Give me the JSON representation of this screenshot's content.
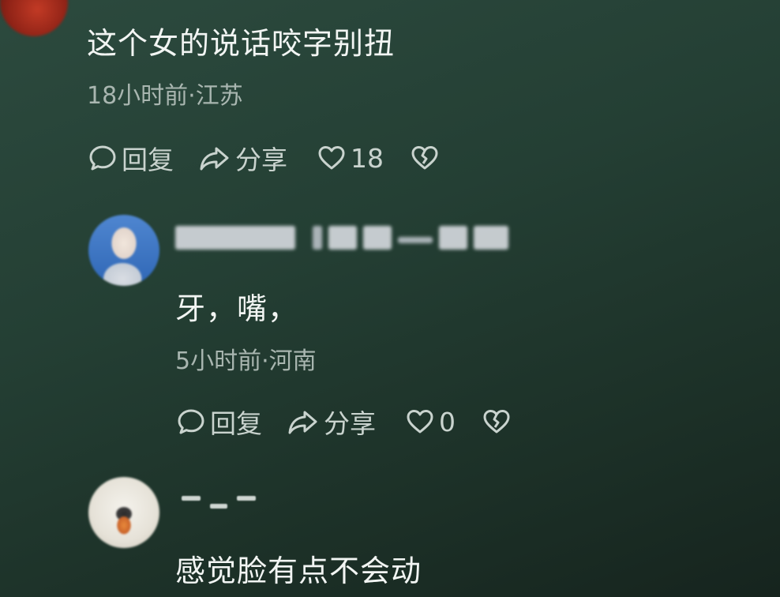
{
  "comments": [
    {
      "text": "这个女的说话咬字别扭",
      "meta": "18小时前·江苏",
      "actions": {
        "reply": "回复",
        "share": "分享",
        "like_count": "18"
      }
    },
    {
      "username": "",
      "text": "牙，嘴，",
      "meta": "5小时前·河南",
      "actions": {
        "reply": "回复",
        "share": "分享",
        "like_count": "0"
      }
    },
    {
      "username": "—_—",
      "text": "感觉脸有点不会动"
    }
  ],
  "icons": {
    "reply": "speech-bubble-icon",
    "share": "share-arrow-icon",
    "like": "heart-outline-icon",
    "dislike": "broken-heart-icon"
  },
  "colors": {
    "background": "#243f34",
    "text": "#f2f5f3",
    "meta": "#a9b6b0",
    "action": "#c9d3ce"
  }
}
